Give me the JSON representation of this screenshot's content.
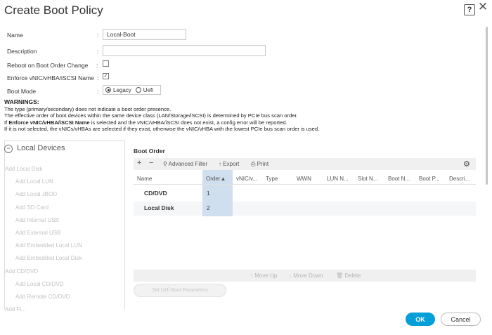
{
  "dialog": {
    "title": "Create Boot Policy",
    "help_icon": "?",
    "close_icon": "✕"
  },
  "form": {
    "name_label": "Name",
    "name_value": "Local-Boot",
    "description_label": "Description",
    "description_value": "",
    "reboot_label": "Reboot on Boot Order Change",
    "reboot_checked": false,
    "enforce_label": "Enforce vNIC/vHBA/iSCSI Name",
    "enforce_checked": true,
    "boot_mode_label": "Boot Mode",
    "boot_mode_options": [
      "Legacy",
      "Uefi"
    ],
    "boot_mode_selected": "Legacy",
    "colon": ":"
  },
  "warnings": {
    "title": "WARNINGS:",
    "line1": "The type (primary/secondary) does not indicate a boot order presence.",
    "line2": "The effective order of boot devices within the same device class (LAN/Storage/iSCSI) is determined by PCIe bus scan order.",
    "line3_pre": "If ",
    "line3_bold": "Enforce vNIC/vHBA/iSCSI Name",
    "line3_post": " is selected and the vNIC/vHBA/iSCSI does not exist, a config error will be reported.",
    "line4": "If it is not selected, the vNICs/vHBAs are selected if they exist, otherwise the vNIC/vHBA with the lowest PCIe bus scan order is used."
  },
  "left_panel": {
    "header": "Local Devices",
    "header_icon": "−",
    "items": [
      {
        "label": "Add Local Disk",
        "indent": 0
      },
      {
        "label": "Add Local LUN",
        "indent": 1
      },
      {
        "label": "Add Local JBOD",
        "indent": 1
      },
      {
        "label": "Add SD Card",
        "indent": 1
      },
      {
        "label": "Add Internal USB",
        "indent": 1
      },
      {
        "label": "Add External USB",
        "indent": 1
      },
      {
        "label": "Add Embedded Local LUN",
        "indent": 1
      },
      {
        "label": "Add Embedded Local Disk",
        "indent": 1
      },
      {
        "label": "Add CD/DVD",
        "indent": 0
      },
      {
        "label": "Add Local CD/DVD",
        "indent": 1
      },
      {
        "label": "Add Remote CD/DVD",
        "indent": 1
      },
      {
        "label": "Add Fl...",
        "indent": 0
      }
    ]
  },
  "boot_order": {
    "title": "Boot Order",
    "toolbar": {
      "add": "+",
      "remove": "−",
      "filter": "Advanced Filter",
      "export": "Export",
      "print": "Print"
    },
    "columns": [
      "Name",
      "Order▲",
      "vNIC/v...",
      "Type",
      "WWN",
      "LUN N...",
      "Slot N...",
      "Boot N...",
      "Boot P...",
      "Descri..."
    ],
    "rows": [
      {
        "name": "CD/DVD",
        "order": "1"
      },
      {
        "name": "Local Disk",
        "order": "2"
      }
    ],
    "move_up": "Move Up",
    "move_down": "Move Down",
    "delete": "Delete",
    "set_uefi": "Set Uefi Boot Parameters"
  },
  "footer": {
    "ok": "OK",
    "cancel": "Cancel"
  },
  "colors": {
    "primary": "#049fd9",
    "order_highlight": "#cfdfee"
  }
}
